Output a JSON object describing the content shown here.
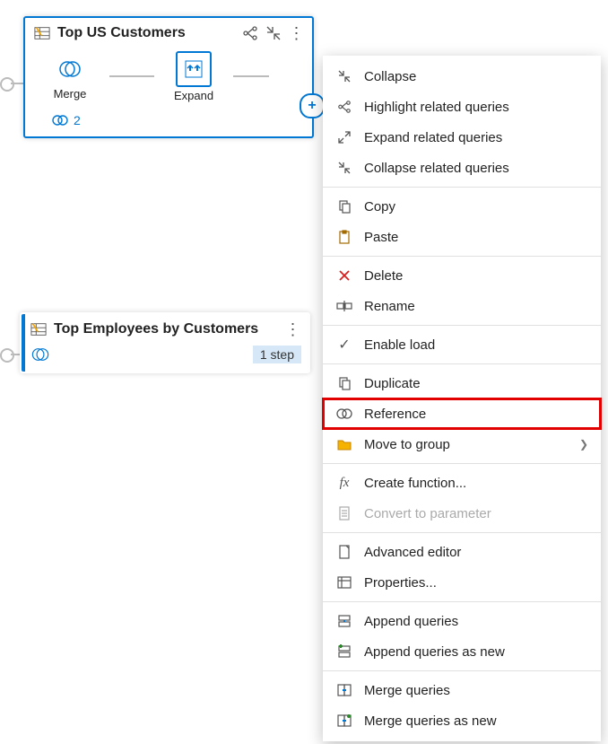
{
  "node1": {
    "title": "Top US Customers",
    "steps": [
      {
        "label": "Merge"
      },
      {
        "label": "Expand"
      }
    ],
    "link_count": "2"
  },
  "node2": {
    "title": "Top Employees by Customers",
    "step_summary": "1 step"
  },
  "menu": {
    "collapse": "Collapse",
    "highlight_related": "Highlight related queries",
    "expand_related": "Expand related queries",
    "collapse_related": "Collapse related queries",
    "copy": "Copy",
    "paste": "Paste",
    "delete": "Delete",
    "rename": "Rename",
    "enable_load": "Enable load",
    "duplicate": "Duplicate",
    "reference": "Reference",
    "move_to_group": "Move to group",
    "create_function": "Create function...",
    "convert_to_parameter": "Convert to parameter",
    "advanced_editor": "Advanced editor",
    "properties": "Properties...",
    "append_queries": "Append queries",
    "append_queries_as_new": "Append queries as new",
    "merge_queries": "Merge queries",
    "merge_queries_as_new": "Merge queries as new"
  }
}
